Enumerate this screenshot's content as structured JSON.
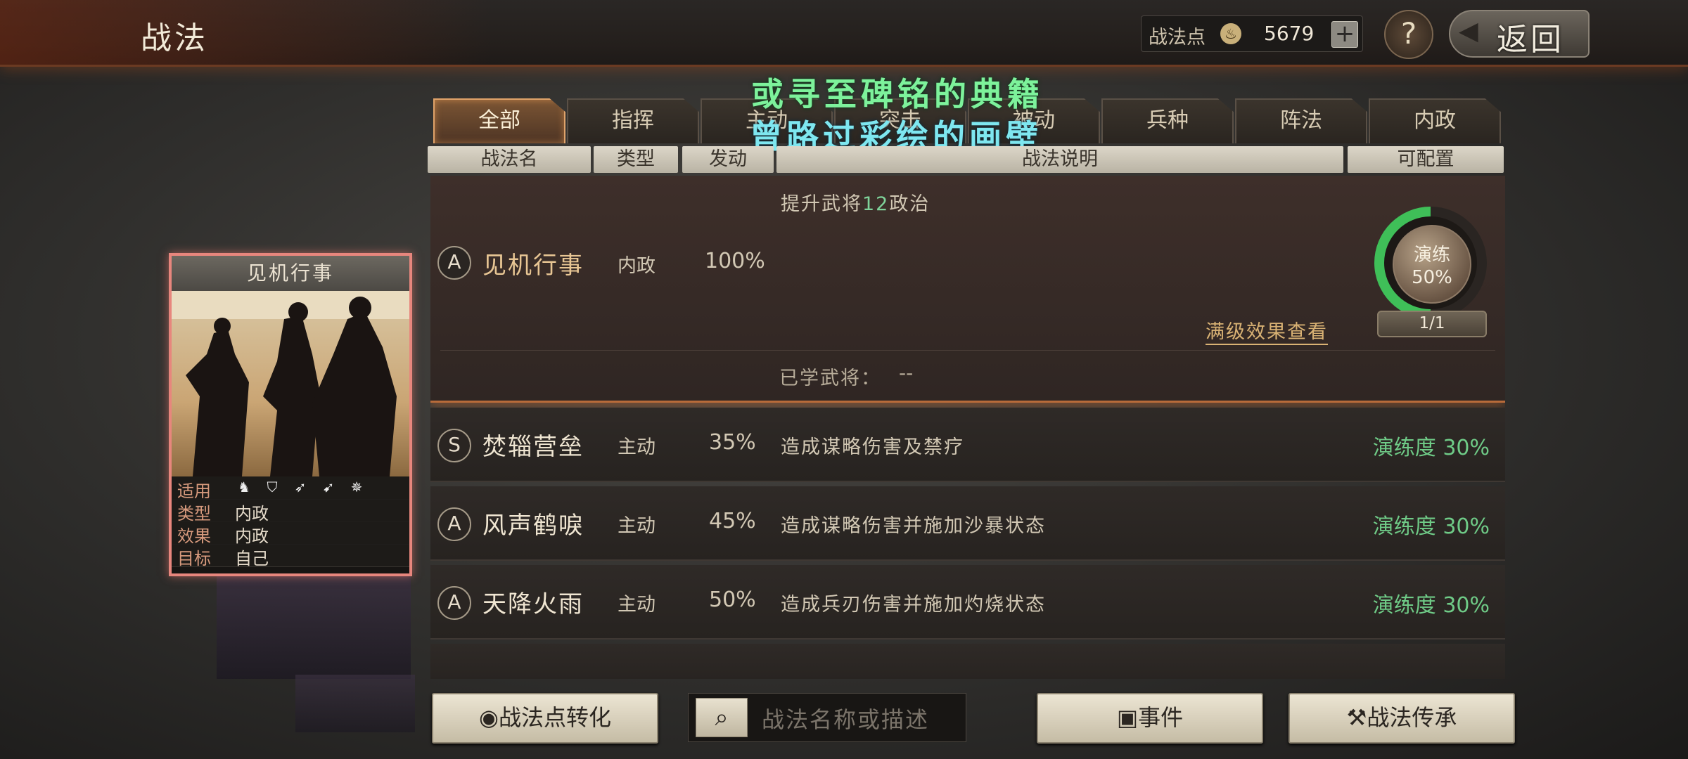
{
  "header": {
    "title": "战法",
    "points_label": "战法点",
    "points_value": "5679",
    "plus": "+",
    "help": "?",
    "back_label": "返回"
  },
  "overlay": {
    "line1": "或寻至碑铭的典籍",
    "line2": "曾路过彩绘的画壁"
  },
  "tabs": [
    "全部",
    "指挥",
    "主动",
    "突击",
    "被动",
    "兵种",
    "阵法",
    "内政"
  ],
  "active_tab": "全部",
  "columns": [
    "战法名",
    "类型",
    "发动",
    "战法说明",
    "可配置"
  ],
  "selected": {
    "grade": "A",
    "name": "见机行事",
    "type": "内政",
    "pct": "100%",
    "desc_prefix": "提升武将",
    "desc_num": "12",
    "desc_suffix": "政治",
    "max_link": "满级效果查看",
    "learned_label": "已学武将：",
    "learned_value": "--",
    "train_label": "演练",
    "train_value": "50%",
    "train_progress": 0.5,
    "count": "1/1"
  },
  "rows": [
    {
      "grade": "S",
      "name": "焚辎营垒",
      "type": "主动",
      "pct": "35%",
      "desc": "造成谋略伤害及禁疗",
      "train": "演练度 30%"
    },
    {
      "grade": "A",
      "name": "风声鹤唳",
      "type": "主动",
      "pct": "45%",
      "desc": "造成谋略伤害并施加沙暴状态",
      "train": "演练度 30%"
    },
    {
      "grade": "A",
      "name": "天降火雨",
      "type": "主动",
      "pct": "50%",
      "desc": "造成兵刃伤害并施加灼烧状态",
      "train": "演练度 30%"
    }
  ],
  "card": {
    "title": "见机行事",
    "applies_label": "适用",
    "type_label": "类型",
    "type_value": "内政",
    "effect_label": "效果",
    "effect_value": "内政",
    "target_label": "目标",
    "target_value": "自己",
    "unit_icons": [
      "cavalry-icon",
      "shield-icon",
      "bow-icon",
      "spear-icon",
      "wheel-icon"
    ]
  },
  "bottom": {
    "convert": "战法点转化",
    "search_placeholder": "战法名称或描述",
    "events": "事件",
    "inherit": "战法传承"
  },
  "colors": {
    "accent_green": "#6fcb87",
    "active_tab": "#e0a36a",
    "card_border": "#e7867d"
  }
}
